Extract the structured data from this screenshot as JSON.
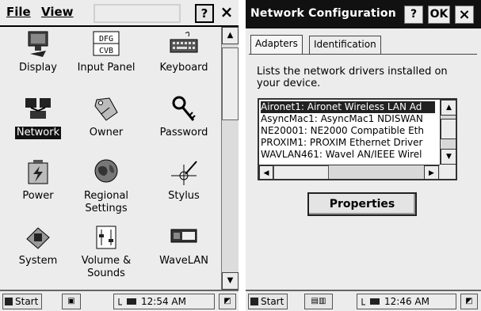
{
  "control_panel": {
    "menu": {
      "file": "File",
      "view": "View"
    },
    "toolbar": {
      "help": "?",
      "close": "×"
    },
    "items": [
      {
        "label": "Display",
        "icon": "display-icon"
      },
      {
        "label": "Input Panel",
        "icon": "input-panel-icon",
        "icon_text_1": "DFG",
        "icon_text_2": "CVB"
      },
      {
        "label": "Keyboard",
        "icon": "keyboard-icon"
      },
      {
        "label": "Network",
        "icon": "network-icon",
        "selected": true
      },
      {
        "label": "Owner",
        "icon": "owner-icon"
      },
      {
        "label": "Password",
        "icon": "password-icon"
      },
      {
        "label": "Power",
        "icon": "power-icon"
      },
      {
        "label": "Regional Settings",
        "icon": "regional-settings-icon"
      },
      {
        "label": "Stylus",
        "icon": "stylus-icon"
      },
      {
        "label": "System",
        "icon": "system-icon"
      },
      {
        "label": "Volume & Sounds",
        "icon": "volume-sounds-icon"
      },
      {
        "label": "WaveLAN",
        "icon": "wavelan-icon"
      }
    ]
  },
  "taskbar_left": {
    "start": "Start",
    "time": "12:54 AM"
  },
  "network_config": {
    "title": "Network Configuration",
    "help": "?",
    "ok": "OK",
    "close": "×",
    "tabs": [
      "Adapters",
      "Identification"
    ],
    "description": "Lists the network drivers installed on your device.",
    "adapters": [
      "Aironet1: Aironet Wireless LAN Ad",
      "AsyncMac1: AsyncMac1 NDISWAN",
      "NE20001: NE2000 Compatible Eth",
      "PROXIM1: PROXIM Ethernet Driver",
      "WAVLAN461: Wavel AN/IEEE Wirel"
    ],
    "properties": "Properties"
  },
  "taskbar_right": {
    "start": "Start",
    "time": "12:46 AM"
  },
  "colors": {
    "title_bar": "#111111",
    "background": "#ececec",
    "selection": "#222222"
  }
}
